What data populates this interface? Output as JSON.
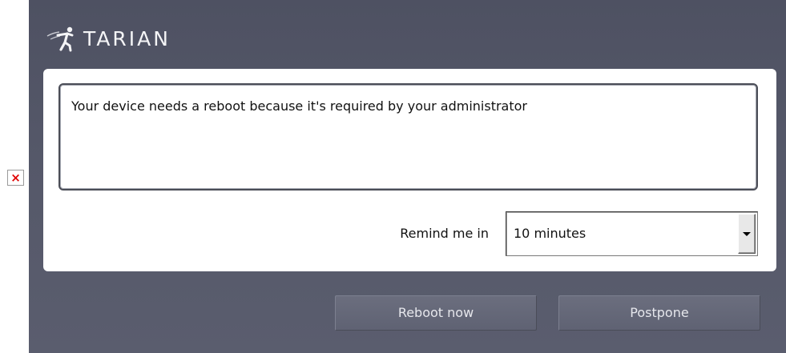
{
  "brand": {
    "name": "TARIAN"
  },
  "message": {
    "text": "Your device needs a reboot because it's required by your administrator"
  },
  "remind": {
    "label": "Remind me in",
    "selected": "10 minutes"
  },
  "buttons": {
    "reboot": "Reboot now",
    "postpone": "Postpone"
  },
  "icons": {
    "broken_image": "broken-image-icon",
    "dropdown": "dropdown-arrow-icon"
  },
  "colors": {
    "dialog_background": "#555869",
    "button_background": "#656878",
    "broken_image_x": "#e00000"
  }
}
